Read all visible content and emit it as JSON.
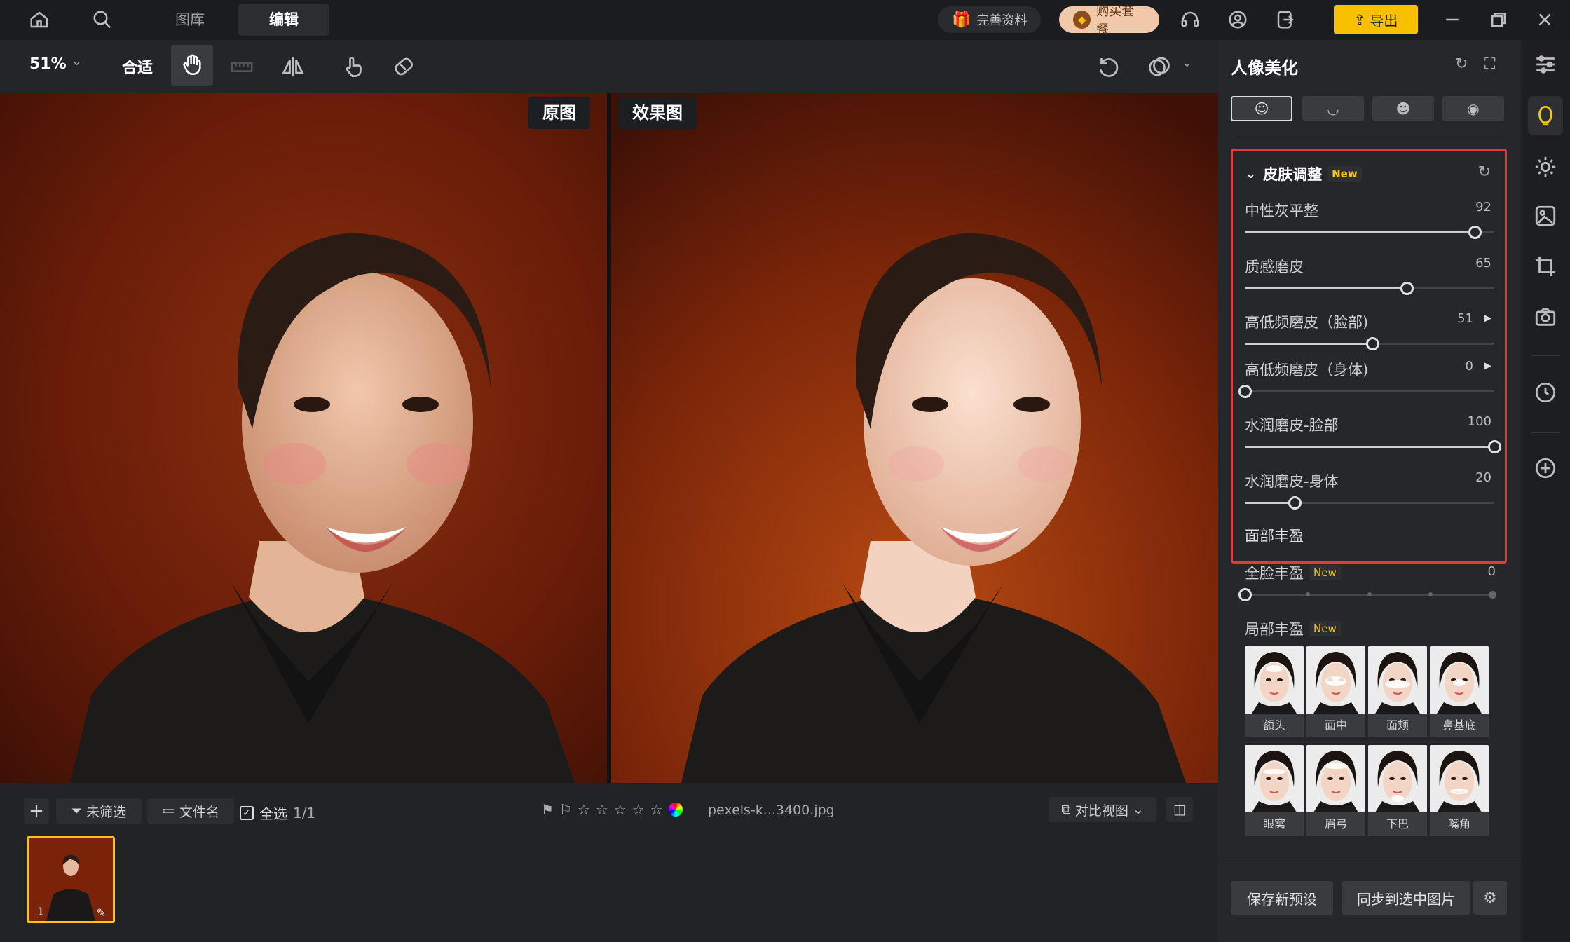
{
  "topbar": {
    "tabs": [
      "图库",
      "编辑"
    ],
    "gift_label": "完善资料",
    "buy_label": "购买套餐",
    "export_label": "导出"
  },
  "toolbar": {
    "zoom": "51%",
    "fit": "合适"
  },
  "canvas": {
    "original_label": "原图",
    "effect_label": "效果图"
  },
  "bottom": {
    "filter": "未筛选",
    "sort": "文件名",
    "select_all": "全选",
    "count": "1/1",
    "filename": "pexels-k...3400.jpg",
    "compare_view": "对比视图",
    "thumb_index": "1"
  },
  "panel": {
    "title": "人像美化",
    "section_title": "皮肤调整",
    "new_badge": "New",
    "sliders": [
      {
        "label": "中性灰平整",
        "value": 92,
        "max": 100,
        "arrow": false
      },
      {
        "label": "质感磨皮",
        "value": 65,
        "max": 100,
        "arrow": false
      },
      {
        "label": "高低频磨皮（脸部)",
        "value": 51,
        "max": 100,
        "arrow": true
      },
      {
        "label": "高低频磨皮（身体)",
        "value": 0,
        "max": 100,
        "arrow": true
      },
      {
        "label": "水润磨皮-脸部",
        "value": 100,
        "max": 100,
        "arrow": false
      },
      {
        "label": "水润磨皮-身体",
        "value": 20,
        "max": 100,
        "arrow": false
      }
    ],
    "face_fill_title": "面部丰盈",
    "full_face_label": "全脸丰盈",
    "full_face_value": 0,
    "local_fill_label": "局部丰盈",
    "thumbs": [
      "额头",
      "面中",
      "面颊",
      "鼻基底",
      "眼窝",
      "眉弓",
      "下巴",
      "嘴角"
    ],
    "save_preset": "保存新预设",
    "sync": "同步到选中图片"
  }
}
